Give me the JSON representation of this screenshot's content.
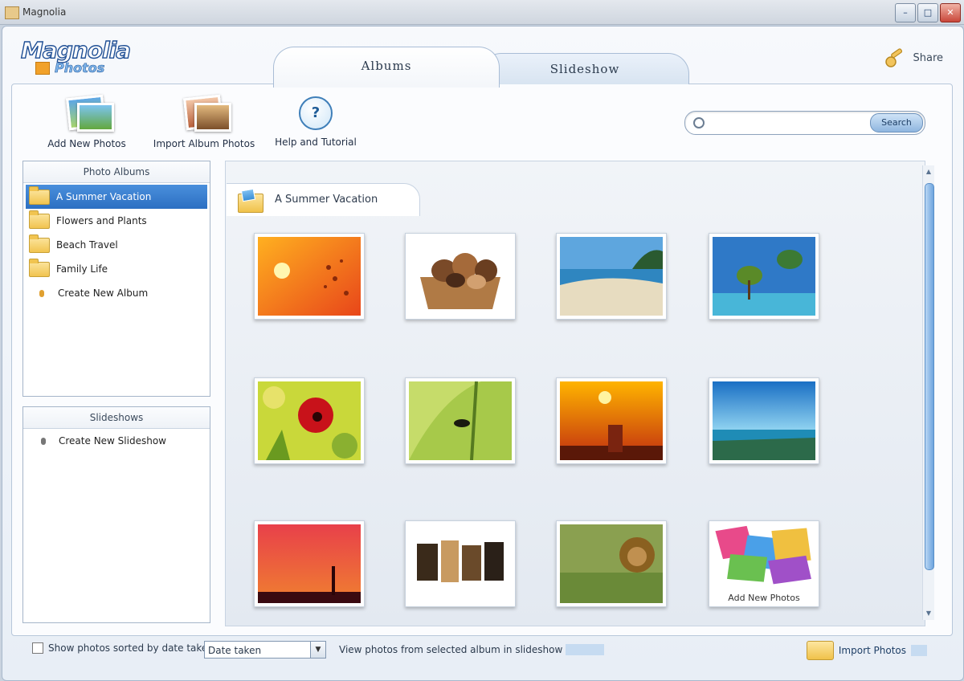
{
  "window": {
    "title": "Magnolia"
  },
  "brand": {
    "line1": "Magnolia",
    "line2": "Photos"
  },
  "tabs": [
    {
      "label": "Albums",
      "active": true
    },
    {
      "label": "Slideshow",
      "active": false
    }
  ],
  "user": {
    "label": "Share"
  },
  "toolbar": [
    {
      "label": "Add New Photos",
      "icon": "add-photos-icon"
    },
    {
      "label": "Import Album Photos",
      "icon": "import-album-icon"
    },
    {
      "label": "Help and Tutorial",
      "icon": "help-icon"
    }
  ],
  "search": {
    "placeholder": "",
    "button_label": "Search"
  },
  "albums_panel": {
    "title": "Photo Albums",
    "items": [
      {
        "label": "A Summer Vacation",
        "selected": true,
        "type": "folder"
      },
      {
        "label": "Flowers and Plants",
        "selected": false,
        "type": "folder"
      },
      {
        "label": "Beach Travel",
        "selected": false,
        "type": "folder"
      },
      {
        "label": "Family Life",
        "selected": false,
        "type": "folder"
      },
      {
        "label": "Create New Album",
        "selected": false,
        "type": "bullet"
      }
    ]
  },
  "slideshow_panel": {
    "title": "Slideshows",
    "items": [
      {
        "label": "Create New Slideshow"
      }
    ]
  },
  "gallery": {
    "title": "A Summer Vacation",
    "photos": [
      {
        "caption": ""
      },
      {
        "caption": ""
      },
      {
        "caption": ""
      },
      {
        "caption": ""
      },
      {
        "caption": ""
      },
      {
        "caption": ""
      },
      {
        "caption": ""
      },
      {
        "caption": ""
      },
      {
        "caption": ""
      },
      {
        "caption": ""
      },
      {
        "caption": ""
      },
      {
        "caption": "Add New Photos"
      }
    ]
  },
  "statusbar": {
    "sort_label": "Show photos sorted by date taken:",
    "sort_value": "Date taken",
    "status_text": "View photos from selected album in slideshow",
    "right_label": "Import Photos"
  }
}
